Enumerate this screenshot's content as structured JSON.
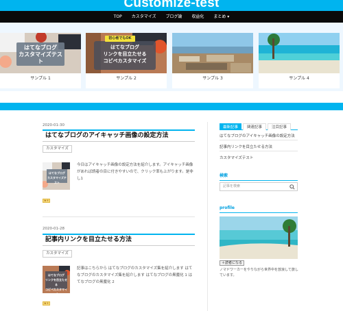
{
  "site": {
    "title": "Customize-test"
  },
  "nav": [
    "TOP",
    "カスタマイズ",
    "ブログ論",
    "収益化",
    "まとめ ▾"
  ],
  "pickup": [
    {
      "caption": "サンプル 1",
      "thumb_text": "はてなブログ\nカスタマイズテスト"
    },
    {
      "caption": "サンプル 2",
      "thumb_text": "はてなブログ\nリンクを目立たせる\nコピペカスタマイズ",
      "thumb_badge": "初心者でもOK"
    },
    {
      "caption": "サンプル 3"
    },
    {
      "caption": "サンプル 4"
    }
  ],
  "posts": [
    {
      "date": "2020-01-30",
      "title": "はてなブログのアイキャッチ画像の設定方法",
      "category": "カスタマイズ",
      "excerpt": "今日はアイキャッチ画像の設定方法を紹介します。アイキャッチ画像があれば読者の目に付きやすいので、クリック率も上がります。是非し1",
      "thumb_text": "はてなブログ\nカスタマイズテスト",
      "star": "★+"
    },
    {
      "date": "2020-01-28",
      "title": "記事内リンクを目立たせる方法",
      "category": "カスタマイズ",
      "excerpt": "記事はこちらから はてなブログのカスタマイズ集を紹介します はてなブログのカスタマイズ集を紹介します はてなブログの黒魔化 1 はてなブログの黒魔化 2",
      "thumb_text": "はてなブログ\nリンクを目立たせる\nコピペカスタマイズ",
      "star": "★+"
    }
  ],
  "sidebar": {
    "tabs": [
      "最新記事",
      "関連記事",
      "注目記事"
    ],
    "links": [
      "はてなブログのアイキャッチ画像の設定方法",
      "記事内リンクを目立たせる方法",
      "カスタマイズテスト"
    ],
    "search_heading": "検索",
    "search_placeholder": "記事を検索",
    "profile_heading": "profile",
    "follow_label": "＋読者になる",
    "bio": "ノマドワーカーをやりながら世界中を放浪して旅しています。"
  },
  "colors": {
    "accent": "#00b4ef",
    "nav_bg": "#0a0a0a",
    "pickup_bg": "#eef7ff"
  }
}
